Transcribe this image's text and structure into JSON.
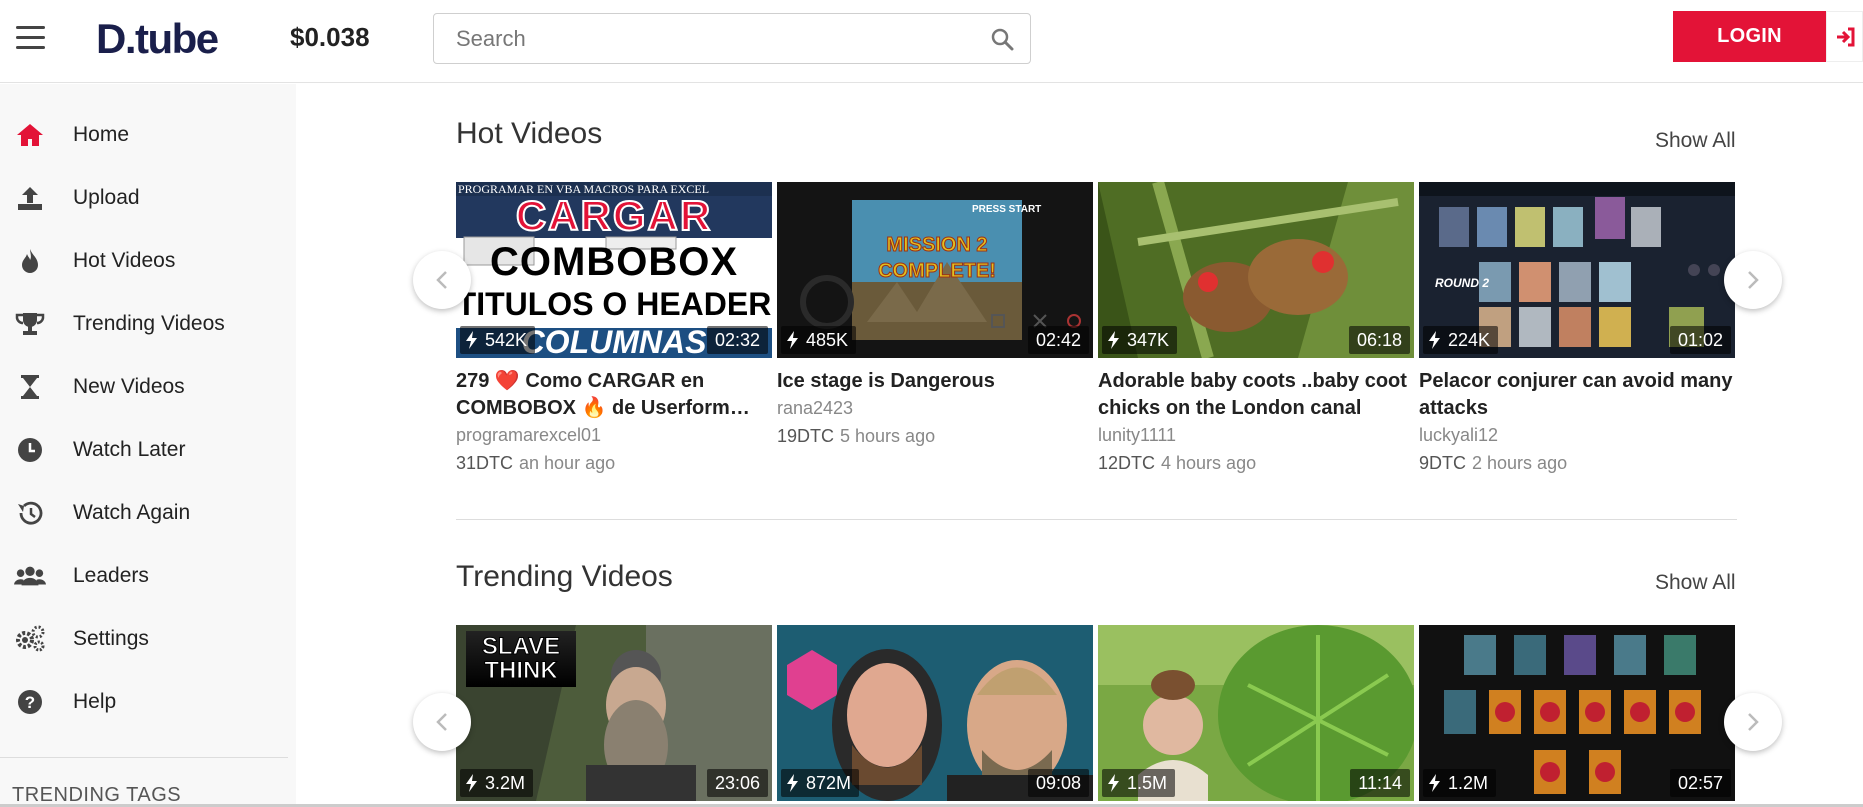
{
  "header": {
    "logo": "D.tube",
    "price": "$0.038",
    "search_placeholder": "Search",
    "login_label": "LOGIN"
  },
  "sidebar": {
    "items": [
      {
        "label": "Home",
        "icon": "home-icon"
      },
      {
        "label": "Upload",
        "icon": "upload-icon"
      },
      {
        "label": "Hot Videos",
        "icon": "flame-icon"
      },
      {
        "label": "Trending Videos",
        "icon": "trophy-icon"
      },
      {
        "label": "New Videos",
        "icon": "hourglass-icon"
      },
      {
        "label": "Watch Later",
        "icon": "clock-icon"
      },
      {
        "label": "Watch Again",
        "icon": "history-icon"
      },
      {
        "label": "Leaders",
        "icon": "users-icon"
      },
      {
        "label": "Settings",
        "icon": "gears-icon"
      },
      {
        "label": "Help",
        "icon": "help-icon"
      }
    ],
    "trending_tags_label": "TRENDING TAGS"
  },
  "hot": {
    "title": "Hot Videos",
    "show_all": "Show All",
    "videos": [
      {
        "title": "279 ❤️ Como CARGAR en COMBOBOX 🔥 de Userform…",
        "author": "programarexcel01",
        "dtc": "31DTC",
        "ago": "an hour ago",
        "views": "542K",
        "duration": "02:32"
      },
      {
        "title": "Ice stage is Dangerous",
        "author": "rana2423",
        "dtc": "19DTC",
        "ago": "5 hours ago",
        "views": "485K",
        "duration": "02:42"
      },
      {
        "title": "Adorable baby coots ..baby coot chicks on the London canal",
        "author": "lunity1111",
        "dtc": "12DTC",
        "ago": "4 hours ago",
        "views": "347K",
        "duration": "06:18"
      },
      {
        "title": "Pelacor conjurer can avoid many attacks",
        "author": "luckyali12",
        "dtc": "9DTC",
        "ago": "2 hours ago",
        "views": "224K",
        "duration": "01:02"
      }
    ]
  },
  "trending": {
    "title": "Trending Videos",
    "show_all": "Show All",
    "videos": [
      {
        "views": "3.2M",
        "duration": "23:06",
        "thumb_text": "SLAVE THINK"
      },
      {
        "views": "872M",
        "duration": "09:08"
      },
      {
        "views": "1.5M",
        "duration": "11:14"
      },
      {
        "views": "1.2M",
        "duration": "02:57"
      }
    ]
  },
  "thumb_texts": {
    "v1_top": "PROGRAMAR EN VBA MACROS PARA EXCEL",
    "v1_l1": "CARGAR",
    "v1_l2": "COMBOBOX",
    "v1_l3": "TITULOS O HEADER",
    "v1_l4": "COLUMNAS",
    "v2_l1": "MISSION 2",
    "v2_l2": "COMPLETE!",
    "v2_press": "PRESS START",
    "v4_round": "ROUND 2"
  },
  "colors": {
    "accent": "#e31337",
    "logo": "#1a1f4b"
  }
}
